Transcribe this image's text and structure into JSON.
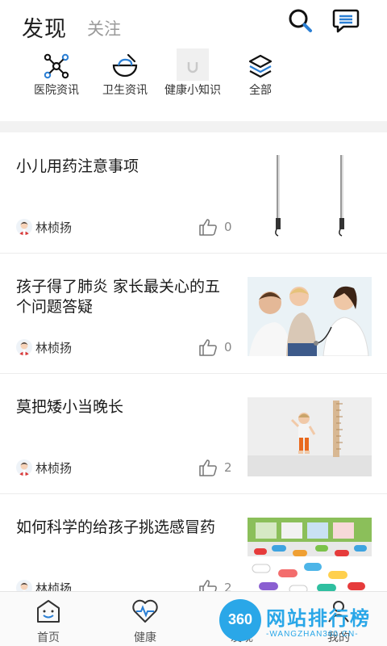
{
  "header": {
    "active_tab": "发现",
    "inactive_tab": "关注",
    "search_icon": "search-icon",
    "message_icon": "message-icon",
    "accent": "#2b7fd4"
  },
  "categories": [
    {
      "label": "医院资讯",
      "icon": "network-icon"
    },
    {
      "label": "卫生资讯",
      "icon": "bowl-icon"
    },
    {
      "label": "健康小知识",
      "icon": "magnet-icon"
    },
    {
      "label": "全部",
      "icon": "layers-icon"
    }
  ],
  "articles": [
    {
      "title": "小儿用药注意事项",
      "author": "林桢扬",
      "likes": "0",
      "thumb": "hooks-image"
    },
    {
      "title": "孩子得了肺炎 家长最关心的五个问题答疑",
      "author": "林桢扬",
      "likes": "0",
      "thumb": "doctor-child-image"
    },
    {
      "title": "莫把矮小当晚长",
      "author": "林桢扬",
      "likes": "2",
      "thumb": "height-chart-image"
    },
    {
      "title": "如何科学的给孩子挑选感冒药",
      "author": "林桢扬",
      "likes": "2",
      "thumb": "pills-image"
    }
  ],
  "bottom_nav": [
    {
      "label": "首页",
      "icon": "smile-home-icon"
    },
    {
      "label": "健康",
      "icon": "heart-pulse-icon"
    },
    {
      "label": "发现",
      "icon": "compass-icon"
    },
    {
      "label": "我的",
      "icon": "user-icon"
    }
  ],
  "watermark": {
    "logo": "360",
    "title": "网站排行榜",
    "subtitle": "-WANGZHAN360.CN-"
  }
}
